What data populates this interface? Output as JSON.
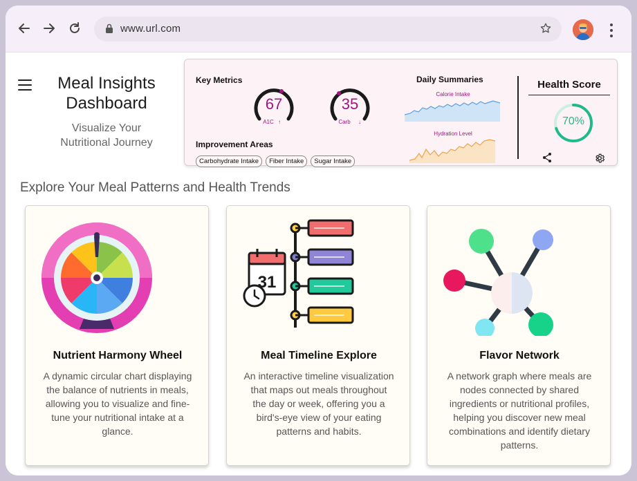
{
  "browser": {
    "url": "www.url.com"
  },
  "header": {
    "title": "Meal Insights Dashboard",
    "subtitle": "Visualize Your Nutritional Journey"
  },
  "metrics": {
    "key_metrics_label": "Key Metrics",
    "gauges": [
      {
        "value": "67",
        "label": "A1C",
        "trend": "↑"
      },
      {
        "value": "35",
        "label": "Carb",
        "trend": "↓"
      }
    ],
    "improvement_label": "Improvement Areas",
    "improvement_areas": [
      "Carbohydrate Intake",
      "Fiber Intake",
      "Sugar Intake"
    ],
    "daily_summaries_label": "Daily Summaries",
    "sparklines": [
      {
        "label": "Calorie Intake",
        "color": "#5aa0e0"
      },
      {
        "label": "Hydration Level",
        "color": "#f0a040"
      }
    ],
    "health_score": {
      "title": "Health Score",
      "value": "70%",
      "fraction": 0.7,
      "color": "#22b98a"
    }
  },
  "section": {
    "title": "Explore Your Meal Patterns and Health Trends"
  },
  "cards": [
    {
      "title": "Nutrient Harmony Wheel",
      "description": "A dynamic circular chart displaying the balance of nutrients in meals, allowing you to visualize and fine-tune your nutritional intake at a glance."
    },
    {
      "title": "Meal Timeline Explore",
      "description": "An interactive timeline visualization that maps out meals throughout the day or week, offering you a bird's-eye view of your eating patterns and habits."
    },
    {
      "title": "Flavor Network",
      "description": "A network graph where meals are nodes connected by shared ingredients or nutritional profiles, helping you discover new meal combinations and identify dietary patterns."
    }
  ],
  "icons": {
    "back": "arrow-left-icon",
    "forward": "arrow-right-icon",
    "reload": "reload-icon",
    "lock": "lock-icon",
    "bookmark": "star-icon",
    "menu": "hamburger-icon",
    "share": "share-icon",
    "settings": "gear-icon",
    "more": "kebab-icon"
  },
  "colors": {
    "accent": "#a0157e",
    "health": "#22b98a",
    "chrome": "#f6eef9"
  },
  "calendar_day": "31"
}
